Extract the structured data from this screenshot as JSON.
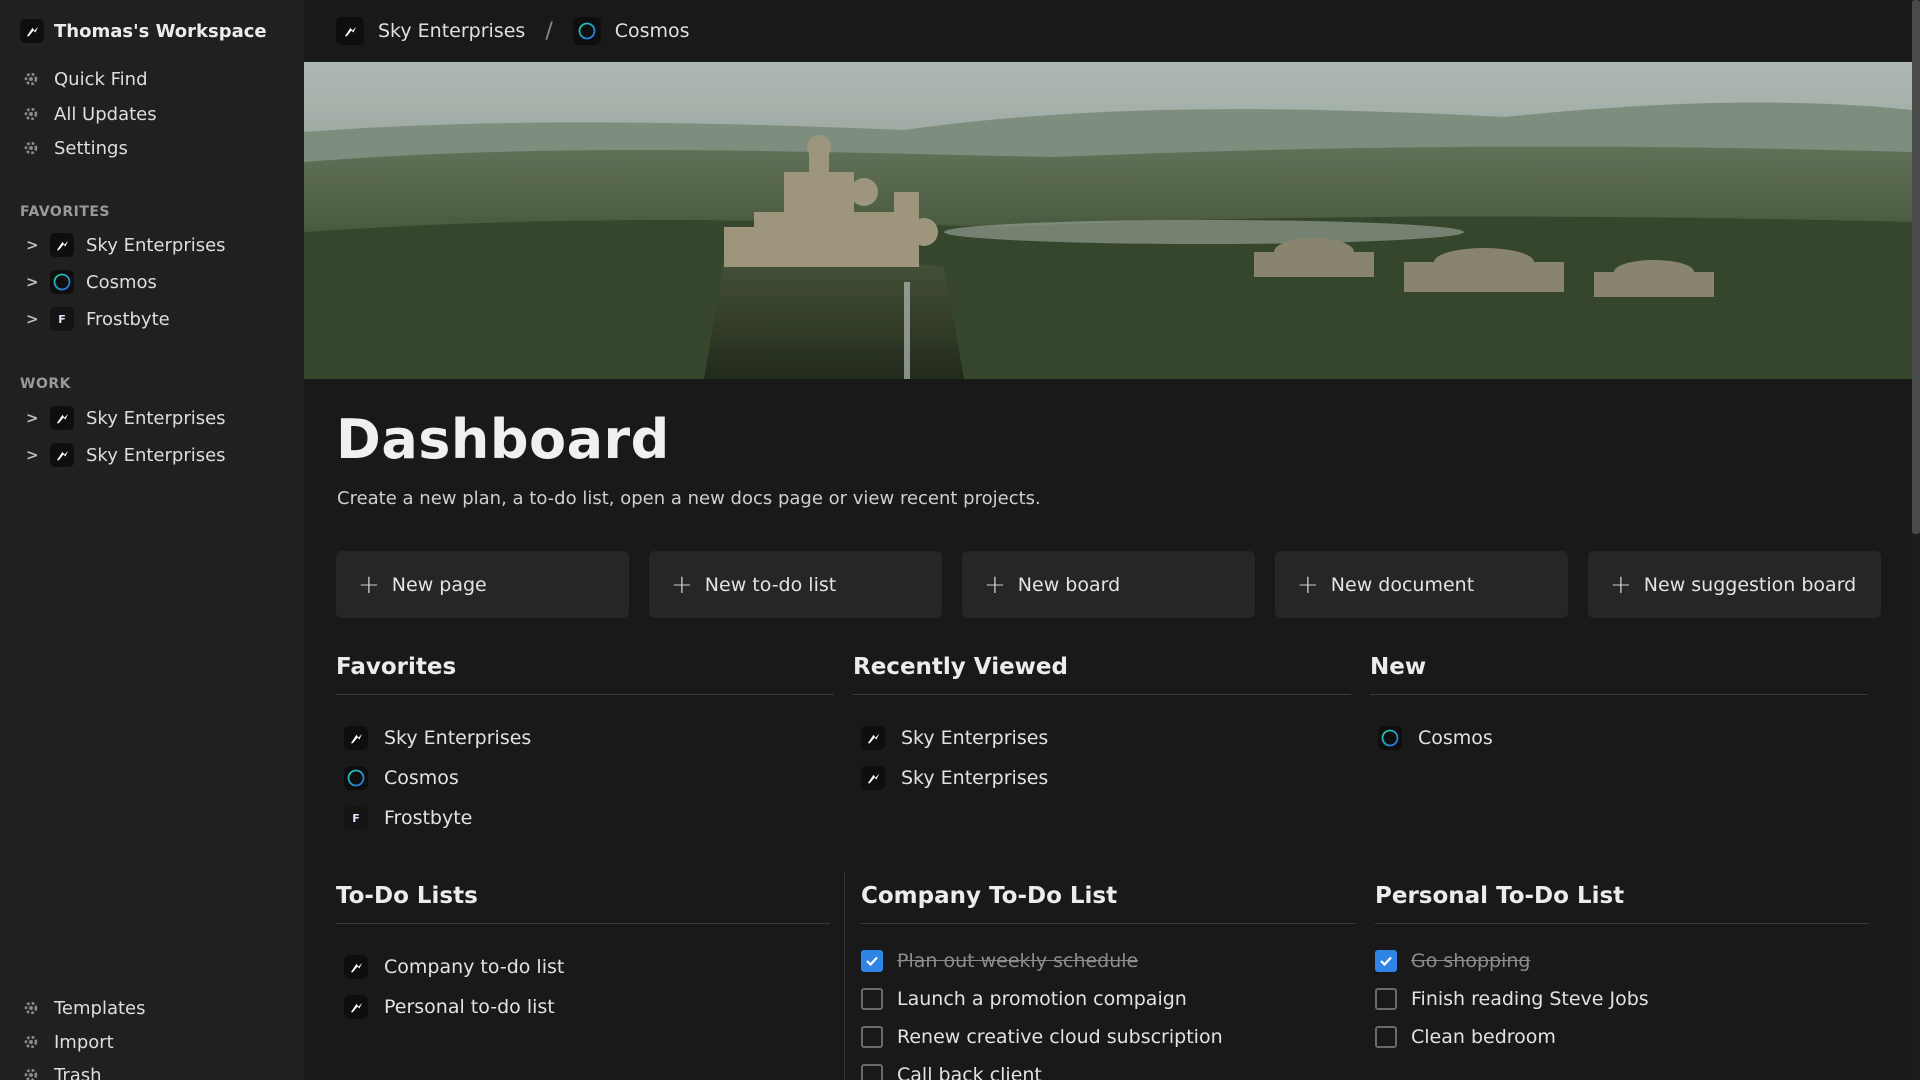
{
  "sidebar": {
    "workspace_title": "Thomas's Workspace",
    "nav": [
      {
        "label": "Quick Find",
        "icon": "gear-icon"
      },
      {
        "label": "All Updates",
        "icon": "gear-icon"
      },
      {
        "label": "Settings",
        "icon": "gear-icon"
      }
    ],
    "favorites_label": "FAVORITES",
    "favorites": [
      {
        "label": "Sky Enterprises",
        "icon": "sky-enterprises-icon"
      },
      {
        "label": "Cosmos",
        "icon": "cosmos-icon"
      },
      {
        "label": "Frostbyte",
        "icon": "frostbyte-icon",
        "icon_letter": "F"
      }
    ],
    "work_label": "WORK",
    "work": [
      {
        "label": "Sky Enterprises",
        "icon": "sky-enterprises-icon"
      },
      {
        "label": "Sky Enterprises",
        "icon": "sky-enterprises-icon"
      }
    ],
    "bottom": [
      {
        "label": "Templates",
        "icon": "gear-icon"
      },
      {
        "label": "Import",
        "icon": "gear-icon"
      },
      {
        "label": "Trash",
        "icon": "gear-icon"
      }
    ]
  },
  "breadcrumb": {
    "items": [
      "Sky Enterprises",
      "Cosmos"
    ],
    "separator": "/"
  },
  "page": {
    "title": "Dashboard",
    "subtitle": "Create a new plan, a to-do list, open a new docs page or view recent projects."
  },
  "actions": [
    "New page",
    "New to-do list",
    "New board",
    "New document",
    "New suggestion board"
  ],
  "favorites": {
    "heading": "Favorites",
    "items": [
      {
        "label": "Sky Enterprises",
        "icon": "sky-enterprises-icon"
      },
      {
        "label": "Cosmos",
        "icon": "cosmos-icon"
      },
      {
        "label": "Frostbyte",
        "icon": "frostbyte-icon",
        "icon_letter": "F"
      }
    ]
  },
  "recently_viewed": {
    "heading": "Recently Viewed",
    "items": [
      {
        "label": "Sky Enterprises",
        "icon": "sky-enterprises-icon"
      },
      {
        "label": "Sky Enterprises",
        "icon": "sky-enterprises-icon"
      }
    ]
  },
  "new_section": {
    "heading": "New",
    "items": [
      {
        "label": "Cosmos",
        "icon": "cosmos-icon"
      }
    ]
  },
  "todo_lists": {
    "heading": "To-Do Lists",
    "items": [
      {
        "label": "Company to-do list",
        "icon": "sky-enterprises-icon"
      },
      {
        "label": "Personal to-do list",
        "icon": "sky-enterprises-icon"
      }
    ]
  },
  "company_todo": {
    "heading": "Company To-Do List",
    "items": [
      {
        "label": "Plan out weekly schedule",
        "checked": true
      },
      {
        "label": "Launch a promotion compaign",
        "checked": false
      },
      {
        "label": "Renew creative cloud subscription",
        "checked": false
      },
      {
        "label": "Call back client",
        "checked": false
      }
    ]
  },
  "personal_todo": {
    "heading": "Personal To-Do List",
    "items": [
      {
        "label": "Go shopping",
        "checked": true
      },
      {
        "label": "Finish reading Steve Jobs",
        "checked": false
      },
      {
        "label": "Clean bedroom",
        "checked": false
      }
    ]
  },
  "colors": {
    "background": "#191919",
    "sidebar": "#202020",
    "card": "#262626",
    "checkbox_accent": "#2f84e6"
  }
}
